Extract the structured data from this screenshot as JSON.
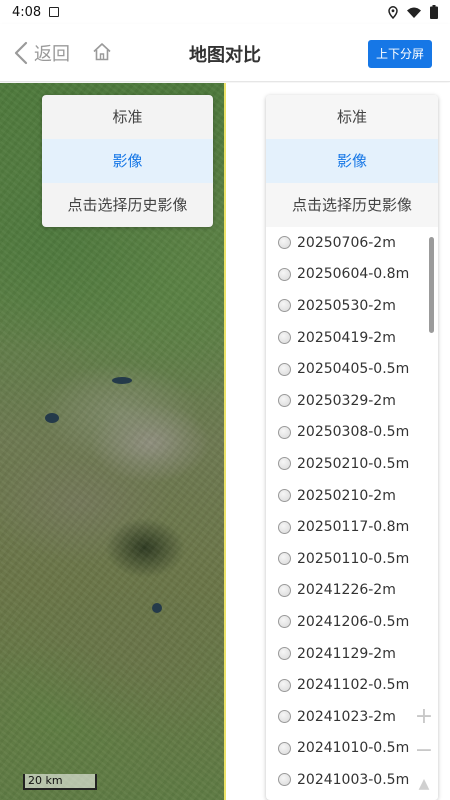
{
  "status_bar": {
    "time": "4:08"
  },
  "header": {
    "back_label": "返回",
    "title": "地图对比",
    "split_label": "上下分屏"
  },
  "left_map": {
    "layers": {
      "standard": "标准",
      "imagery": "影像",
      "history": "点击选择历史影像"
    },
    "scale": "20 km"
  },
  "right_map": {
    "layers": {
      "standard": "标准",
      "imagery": "影像",
      "history": "点击选择历史影像"
    },
    "history_items": [
      "20250706-2m",
      "20250604-0.8m",
      "20250530-2m",
      "20250419-2m",
      "20250405-0.5m",
      "20250329-2m",
      "20250308-0.5m",
      "20250210-0.5m",
      "20250210-2m",
      "20250117-0.8m",
      "20250110-0.5m",
      "20241226-2m",
      "20241206-0.5m",
      "20241129-2m",
      "20241102-0.5m",
      "20241023-2m",
      "20241010-0.5m",
      "20241003-0.5m"
    ],
    "zoom_in": "+",
    "zoom_out": "−"
  },
  "colors": {
    "accent": "#1677e6",
    "active_bg": "#e4f1fc",
    "divider": "#ece36a"
  },
  "icons": [
    "app-notification-icon",
    "location-icon",
    "wifi-icon",
    "battery-icon",
    "back-chevron-icon",
    "home-icon",
    "compass-icon"
  ]
}
